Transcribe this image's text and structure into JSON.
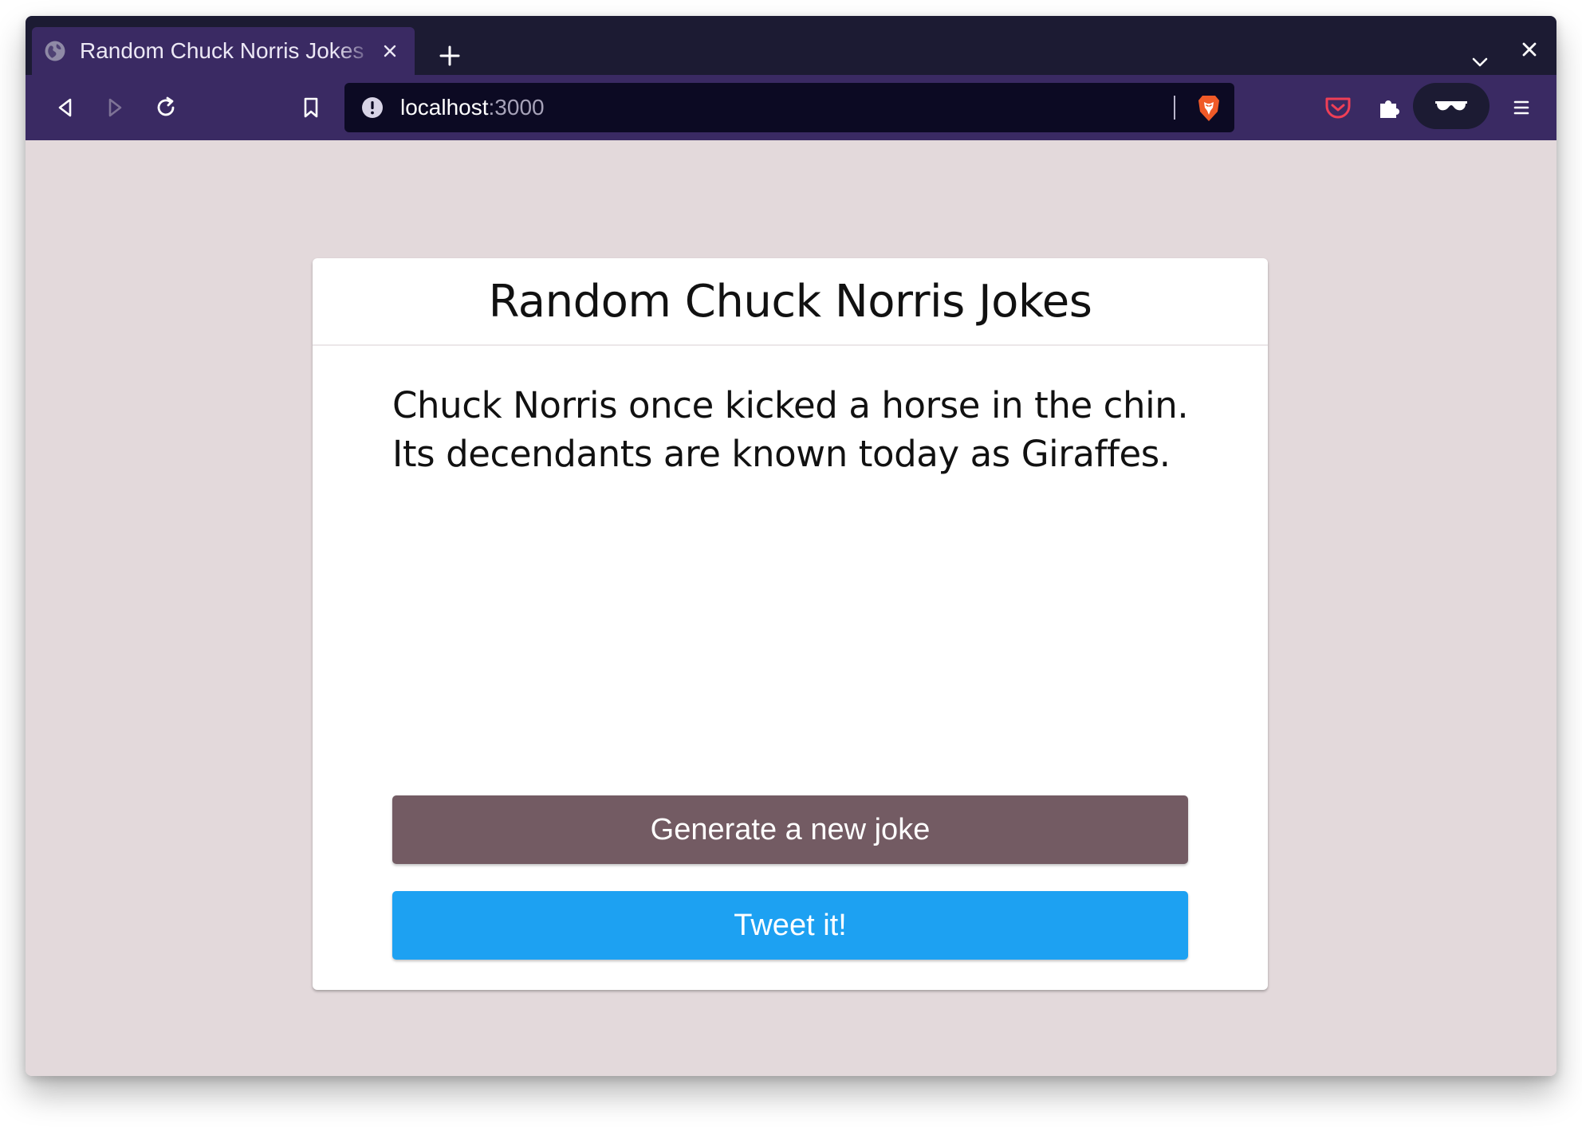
{
  "browser": {
    "tab": {
      "title": "Random Chuck Norris Jokes",
      "icon": "globe-icon"
    },
    "url": {
      "host": "localhost",
      "port": ":3000"
    },
    "icons": {
      "back": "back-icon",
      "forward": "forward-icon",
      "reload": "reload-icon",
      "bookmark": "bookmark-icon",
      "site_info": "site-info-icon",
      "brave": "brave-lion-icon",
      "pocket": "pocket-icon",
      "extensions": "extensions-icon",
      "private": "sunglasses-icon",
      "menu": "menu-icon"
    },
    "colors": {
      "tabbar_bg": "#1c1b33",
      "toolbar_bg": "#3a2a63",
      "urlbar_bg": "#0c0a23"
    }
  },
  "page": {
    "title": "Random Chuck Norris Jokes",
    "joke": "Chuck Norris once kicked a horse in the chin. Its decendants are known today as Giraffes.",
    "buttons": {
      "generate": "Generate a new joke",
      "tweet": "Tweet it!"
    },
    "colors": {
      "page_bg": "#e3d9db",
      "generate_bg": "#735b63",
      "tweet_bg": "#1da1f2"
    }
  }
}
